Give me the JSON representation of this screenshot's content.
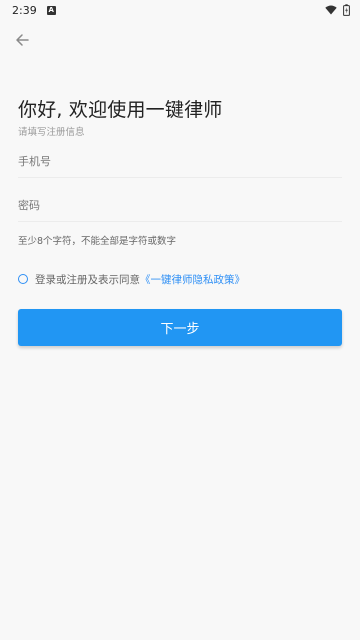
{
  "status_bar": {
    "time": "2:39",
    "icons": [
      "notification-a-icon",
      "wifi-icon",
      "battery-charging-icon"
    ]
  },
  "header": {
    "back_icon": "arrow-left-icon"
  },
  "main": {
    "title": "你好, 欢迎使用一键律师",
    "subtitle": "请填写注册信息",
    "phone_placeholder": "手机号",
    "password_placeholder": "密码",
    "password_hint": "至少8个字符，不能全部是字符或数字",
    "agreement_text": "登录或注册及表示同意",
    "policy_link": "《一键律师隐私政策》",
    "next_button": "下一步"
  },
  "colors": {
    "accent": "#2196f3",
    "link": "#2e8ff5",
    "background": "#f8f8f8"
  }
}
